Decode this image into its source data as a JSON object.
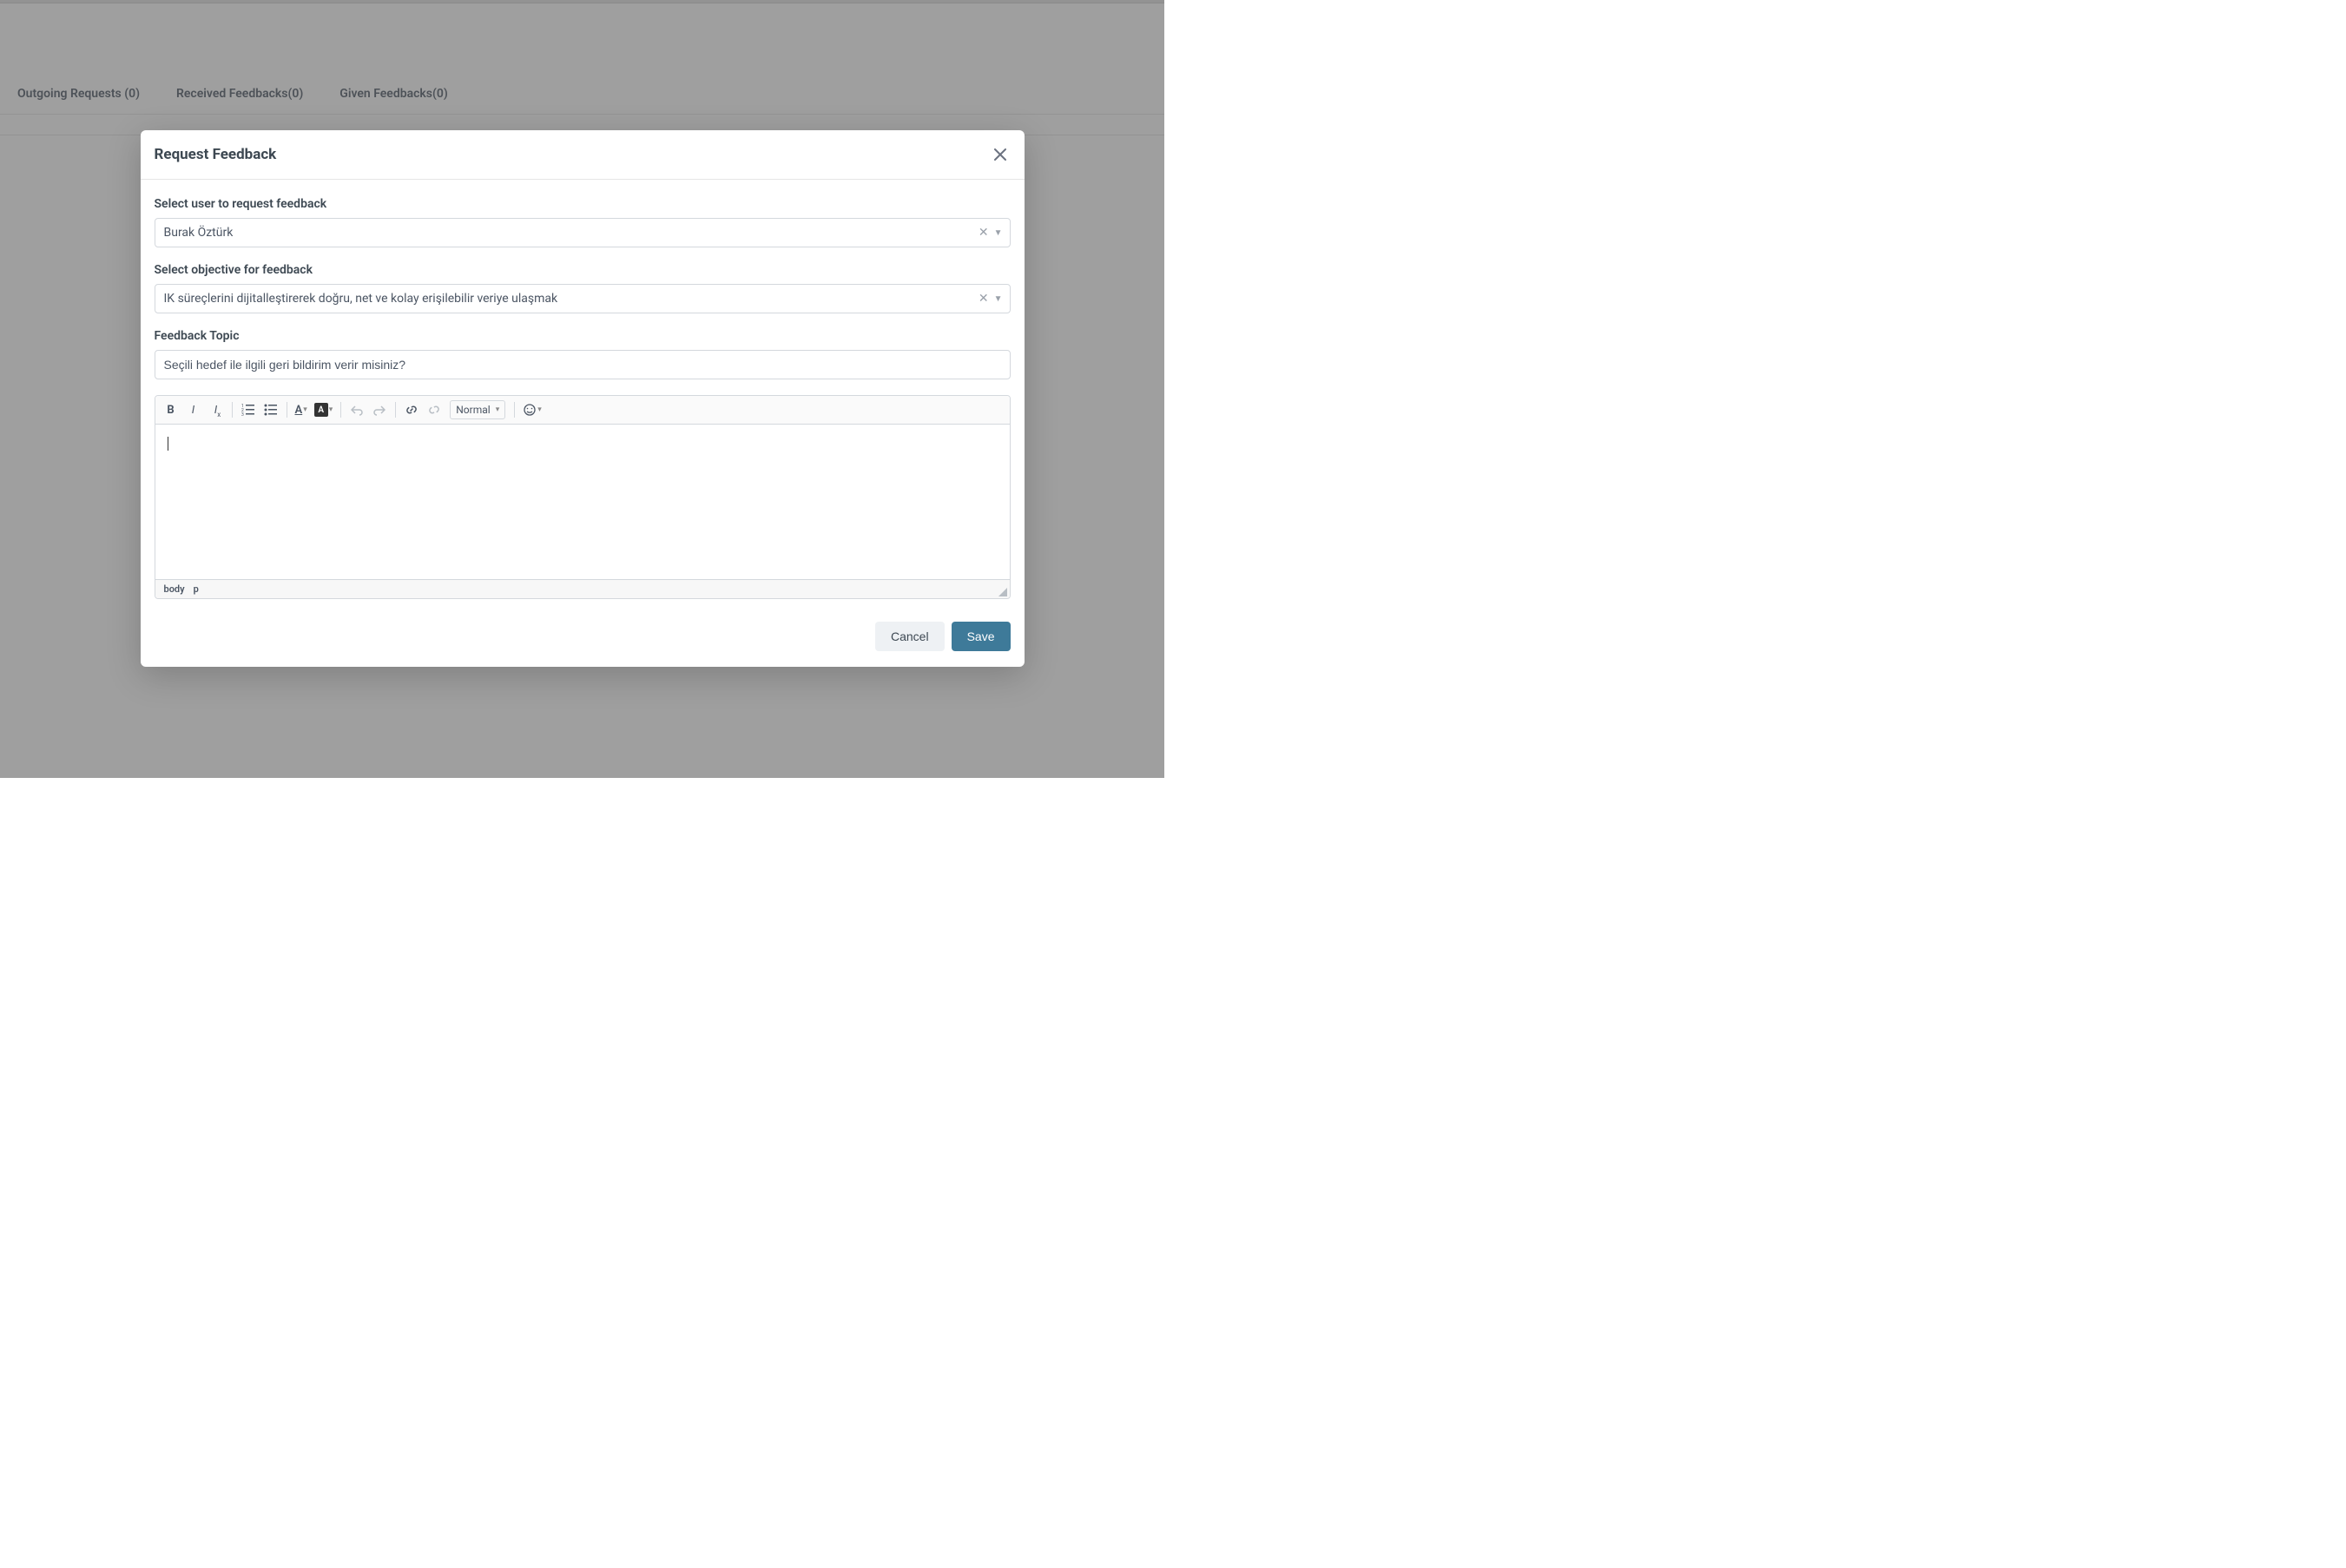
{
  "tabs": {
    "outgoing": "Outgoing Requests (0)",
    "received": "Received Feedbacks(0)",
    "given": "Given Feedbacks(0)"
  },
  "modal": {
    "title": "Request Feedback",
    "labels": {
      "select_user": "Select user to request feedback",
      "select_objective": "Select objective for feedback",
      "feedback_topic": "Feedback Topic"
    },
    "values": {
      "user": "Burak Öztürk",
      "objective": "IK süreçlerini dijitalleştirerek doğru, net ve kolay erişilebilir veriye ulaşmak",
      "topic": "Seçili hedef ile ilgili geri bildirim verir misiniz?"
    },
    "editor": {
      "format": "Normal",
      "path_body": "body",
      "path_p": "p"
    },
    "buttons": {
      "cancel": "Cancel",
      "save": "Save"
    }
  }
}
